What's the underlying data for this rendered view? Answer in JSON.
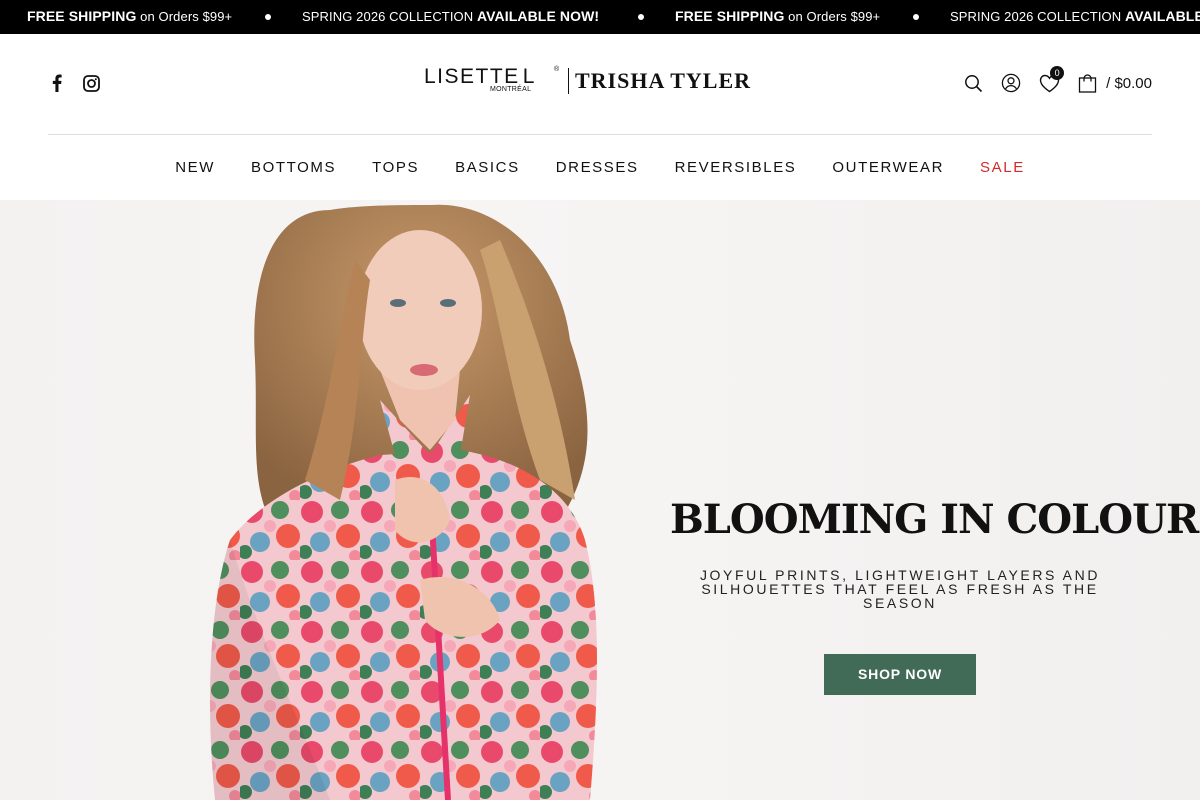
{
  "announcement": {
    "messages": [
      {
        "bold": "FREE SHIPPING",
        "light": " on Orders $99+"
      },
      {
        "light": "SPRING 2026 COLLECTION ",
        "bold": "AVAILABLE NOW!"
      },
      {
        "bold": "FREE SHIPPING",
        "light": " on Orders $99+"
      },
      {
        "light": "SPRING 2026 COLLECTION ",
        "bold": "AVAILABLE NOW!"
      }
    ]
  },
  "header": {
    "social": [
      {
        "icon": "facebook-icon"
      },
      {
        "icon": "instagram-icon"
      }
    ],
    "logo": {
      "lisette": "LISETTE",
      "lisette_mark": "L",
      "registered": "®",
      "montreal": "MONTRÉAL",
      "trisha_tyler": "TRISHA TYLER"
    },
    "utilities": {
      "search_icon": "search-icon",
      "account_icon": "user-icon",
      "wishlist_icon": "heart-icon",
      "wishlist_count": "0",
      "cart_icon": "bag-icon",
      "cart_total": "/ $0.00"
    }
  },
  "nav": {
    "items": [
      "NEW",
      "BOTTOMS",
      "TOPS",
      "BASICS",
      "DRESSES",
      "REVERSIBLES",
      "OUTERWEAR",
      "SALE"
    ]
  },
  "hero": {
    "title": "BLOOMING IN COLOUR",
    "subtitle": "JOYFUL PRINTS, LIGHTWEIGHT LAYERS AND SILHOUETTES THAT FEEL AS FRESH AS THE SEASON",
    "cta": "SHOP NOW",
    "cta_color": "#426b57"
  },
  "colors": {
    "sale": "#d22a2a",
    "announcement_bg": "#000000"
  }
}
